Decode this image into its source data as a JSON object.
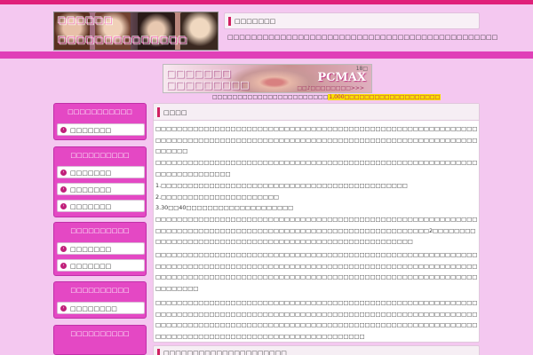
{
  "header": {
    "logo_line1": "□□□□□□",
    "logo_line2": "□□□□□□□□□□□□□□",
    "box_title": "□□□□□□□",
    "description": "□□□□□□□□□□□□□□□□□□□□□□□□□□□□□□□□□□□□□□□□□□□□□□"
  },
  "banner": {
    "copy_line1": "□□□□□□□",
    "copy_line2": "□□□□□□□□□",
    "brand": "PCMAX",
    "age_badge": "18□",
    "cta": "□□♪□□□□□□□□>>>",
    "caption_pre": "□□□□□□□□□□□□□□□□□□□□□□□",
    "caption_highlight": "1,000□□□□□□□□□□□□□□□□□□□",
    "caption_post": ""
  },
  "sidebar": [
    {
      "title": "□□□□□□□□□□□",
      "items": [
        "□□□□□□□"
      ]
    },
    {
      "title": "□□□□□□□□□□",
      "items": [
        "□□□□□□□",
        "□□□□□□□",
        "□□□□□□□"
      ]
    },
    {
      "title": "□□□□□□□□□□",
      "items": [
        "□□□□□□□",
        "□□□□□□□"
      ]
    },
    {
      "title": "□□□□□□□□□□",
      "items": [
        "□□□□□□□□"
      ]
    },
    {
      "title": "□□□□□□□□□□",
      "items": []
    }
  ],
  "main": {
    "title": "□□□□",
    "paragraphs": [
      "□□□□□□□□□□□□□□□□□□□□□□□□□□□□□□□□□□□□□□□□□□□□□□□□□□□□□□□□□□□□□□□□□□□□□□□□□□□□□□□□□□□□□□□□□□□□□□□□□□□□□□□□□□□□□□□□□□□□□□□□□□□□□□",
      "□□□□□□□□□□□□□□□□□□□□□□□□□□□□□□□□□□□□□□□□□□□□□□□□□□□□□□□□□□□□□□□□□□□□□□□□□□",
      "1.□□□□□□□□□□□□□□□□□□□□□□□□□□□□□□□□□□□□□□□□□□□□□□",
      "2.□□□□□□□□□□□□□□□□□□□□□□",
      "3.30□□40□□□□□□□□□□□□□□□□□□□□",
      "□□□□□□□□□□□□□□□□□□□□□□□□□□□□□□□□□□□□□□□□□□□□□□□□□□□□□□□□□□□□□□□□□□□□□□□□□□□□□□□□□□□□□□□□□□□□□□□□□□□□□□□□□□□□□□□2□□□□□□□□□□□□□□□□□□□□□□□□□□□□□□□□□□□□□□□□□□□□□□□□□□□□□□□□",
      "□□□□□□□□□□□□□□□□□□□□□□□□□□□□□□□□□□□□□□□□□□□□□□□□□□□□□□□□□□□□□□□□□□□□□□□□□□□□□□□□□□□□□□□□□□□□□□□□□□□□□□□□□□□□□□□□□□□□□□□□□□□□□□□□□□□□□□□□□□□□□□□□□□□□□□□□□□□□□□□□□□□□□□□□□□□□□□□□□□□□□□□□□□□□",
      "□□□□□□□□□□□□□□□□□□□□□□□□□□□□□□□□□□□□□□□□□□□□□□□□□□□□□□□□□□□□□□□□□□□□□□□□□□□□□□□□□□□□□□□□□□□□□□□□□□□□□□□□□□□□□□□□□□□□□□□□□□□□□□□□□□□□□□□□□□□□□□□□□□□□□□□□□□□□□□□□□□□□□□□□□□□□□□□□□□□□□□□□□□□□□□□□□□□□□□□□□□□□□□□□□□□□□□□□□□□"
    ]
  },
  "sub_section": {
    "title": "□□□□□□□□□□□□□□□□□□□□□"
  }
}
